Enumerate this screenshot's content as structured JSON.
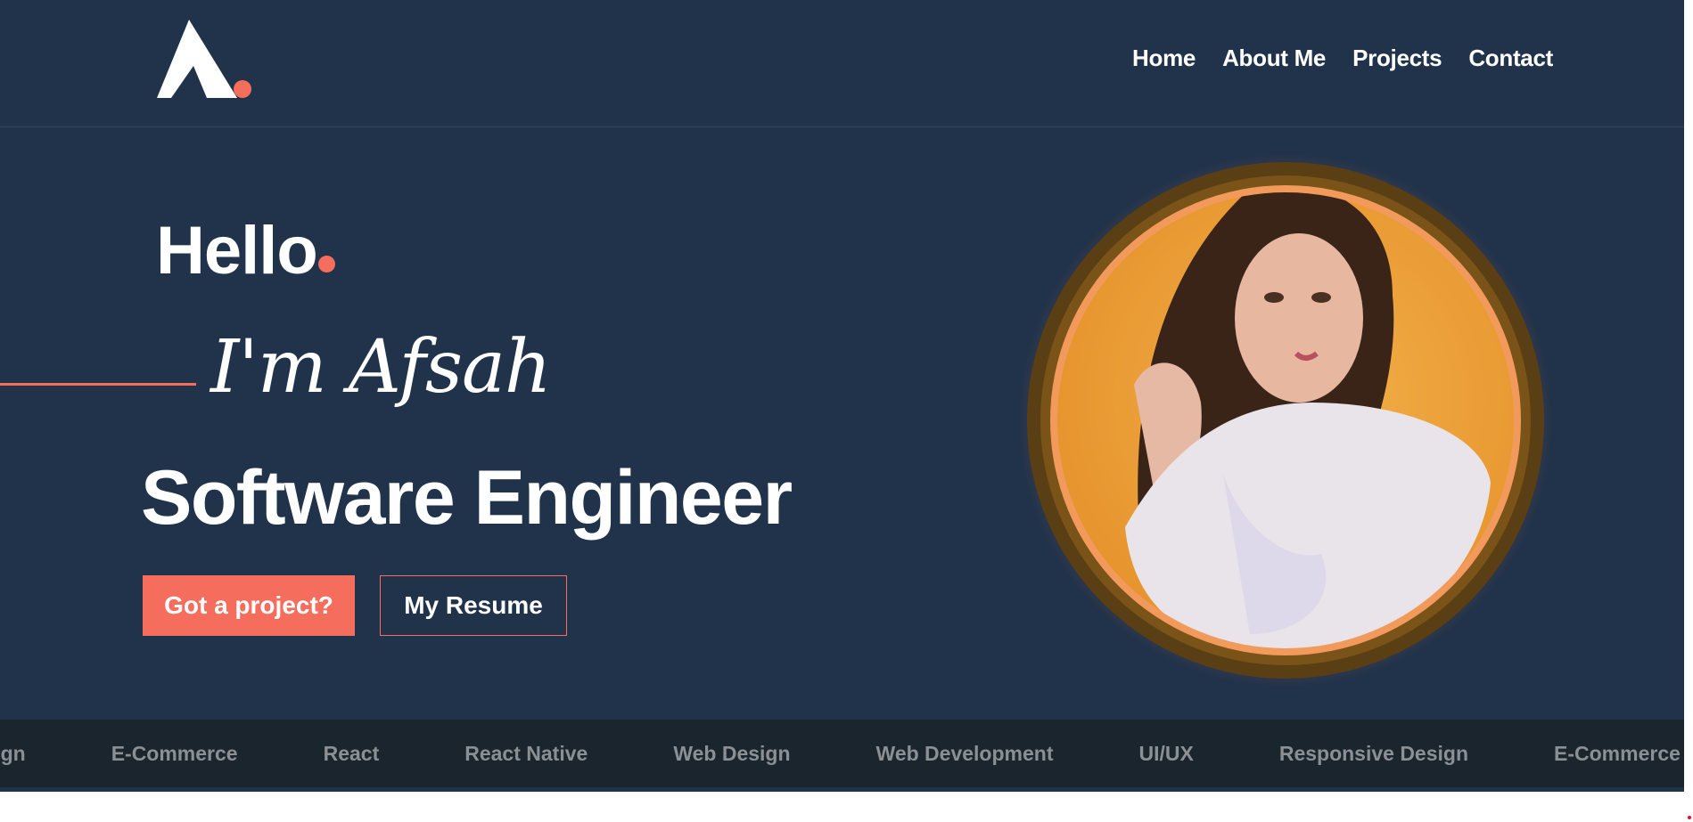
{
  "nav": {
    "items": [
      {
        "label": "Home"
      },
      {
        "label": "About Me"
      },
      {
        "label": "Projects"
      },
      {
        "label": "Contact"
      }
    ]
  },
  "hero": {
    "greeting": "Hello",
    "name": "I'm Afsah",
    "role": "Software Engineer",
    "primary_button": "Got a project?",
    "secondary_button": "My Resume"
  },
  "skills_marquee": [
    "Design",
    "E-Commerce",
    "React",
    "React Native",
    "Web Design",
    "Web Development",
    "UI/UX",
    "Responsive Design",
    "E-Commerce"
  ],
  "colors": {
    "background": "#20334a",
    "accent": "#f56d5d",
    "marquee_bg": "#1b252e",
    "marquee_text": "#8b9095",
    "portrait_ring": "#6b4a1c",
    "portrait_fill": "#f0a030"
  },
  "icons": {
    "logo": "letter-a-logo-icon",
    "portrait": "profile-photo"
  }
}
